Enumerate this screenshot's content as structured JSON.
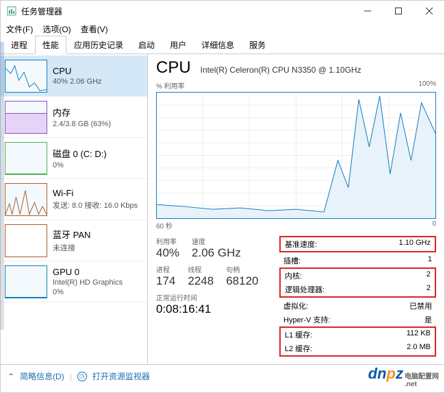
{
  "window": {
    "title": "任务管理器"
  },
  "menu": {
    "file": "文件(F)",
    "options": "选项(O)",
    "view": "查看(V)"
  },
  "tabs": [
    "进程",
    "性能",
    "应用历史记录",
    "启动",
    "用户",
    "详细信息",
    "服务"
  ],
  "sidebar": [
    {
      "title": "CPU",
      "sub": "40% 2.06 GHz"
    },
    {
      "title": "内存",
      "sub": "2.4/3.8 GB (63%)"
    },
    {
      "title": "磁盘 0 (C: D:)",
      "sub": "0%"
    },
    {
      "title": "Wi-Fi",
      "sub": "发送: 8.0 接收: 16.0 Kbps"
    },
    {
      "title": "蓝牙 PAN",
      "sub": "未连接"
    },
    {
      "title": "GPU 0",
      "sub": "Intel(R) HD Graphics",
      "sub2": "0%"
    }
  ],
  "main": {
    "title": "CPU",
    "model": "Intel(R) Celeron(R) CPU N3350 @ 1.10GHz",
    "util_label": "% 利用率",
    "util_max": "100%",
    "x_left": "60 秒",
    "x_right": "0",
    "stats": {
      "util_l": "利用率",
      "util_v": "40%",
      "speed_l": "速度",
      "speed_v": "2.06 GHz",
      "proc_l": "进程",
      "proc_v": "174",
      "thr_l": "线程",
      "thr_v": "2248",
      "hnd_l": "句柄",
      "hnd_v": "68120",
      "uptime_l": "正常运行时间",
      "uptime_v": "0:08:16:41"
    },
    "right": {
      "base_l": "基准速度:",
      "base_v": "1.10 GHz",
      "sock_l": "插槽:",
      "sock_v": "1",
      "core_l": "内核:",
      "core_v": "2",
      "lproc_l": "逻辑处理器:",
      "lproc_v": "2",
      "virt_l": "虚拟化:",
      "virt_v": "已禁用",
      "hv_l": "Hyper-V 支持:",
      "hv_v": "是",
      "l1_l": "L1 缓存:",
      "l1_v": "112 KB",
      "l2_l": "L2 缓存:",
      "l2_v": "2.0 MB"
    }
  },
  "status": {
    "brief": "简略信息(D)",
    "resmon": "打开资源监视器"
  },
  "watermark": {
    "text": "dnpz",
    "sub": "电脑配置网",
    "net": ".net"
  },
  "chart_data": {
    "type": "line",
    "title": "% 利用率",
    "xlabel": "60 秒 → 0",
    "ylabel": "%",
    "ylim": [
      0,
      100
    ],
    "x": [
      60,
      55,
      50,
      45,
      40,
      35,
      30,
      25,
      20,
      15,
      10,
      5,
      0
    ],
    "values": [
      18,
      15,
      12,
      14,
      10,
      11,
      9,
      10,
      55,
      30,
      95,
      40,
      85
    ]
  }
}
